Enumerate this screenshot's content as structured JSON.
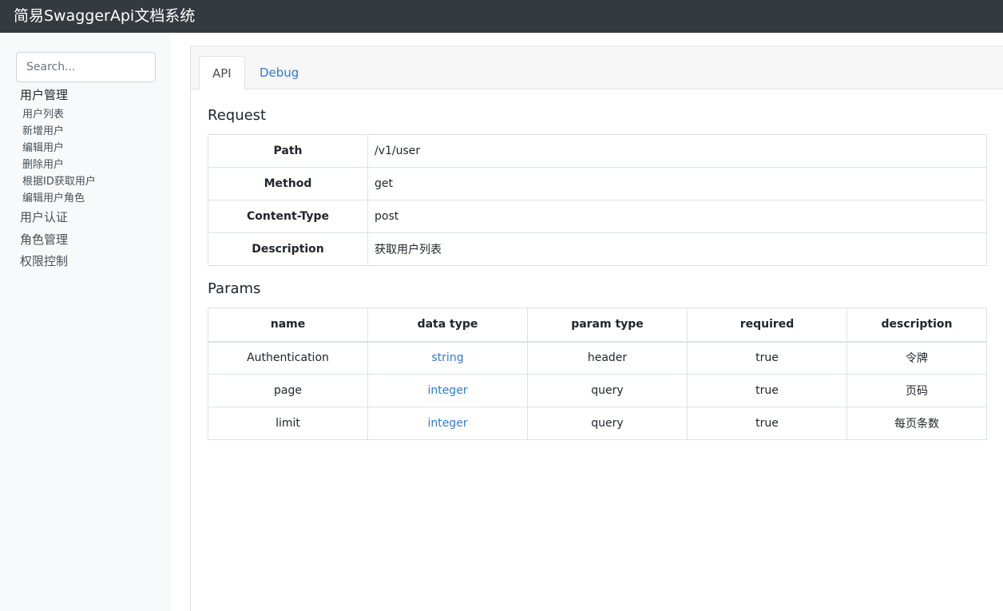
{
  "app": {
    "title": "简易SwaggerApi文档系统"
  },
  "sidebar": {
    "search_placeholder": "Search...",
    "groups": [
      {
        "label": "用户管理",
        "items": [
          "用户列表",
          "新增用户",
          "编辑用户",
          "删除用户",
          "根据ID获取用户",
          "编辑用户角色"
        ]
      },
      {
        "label": "用户认证"
      },
      {
        "label": "角色管理"
      },
      {
        "label": "权限控制"
      }
    ]
  },
  "tabs": [
    {
      "label": "API",
      "active": true
    },
    {
      "label": "Debug",
      "active": false
    }
  ],
  "request": {
    "heading": "Request",
    "rows": [
      {
        "key": "Path",
        "value": "/v1/user"
      },
      {
        "key": "Method",
        "value": "get"
      },
      {
        "key": "Content-Type",
        "value": "post"
      },
      {
        "key": "Description",
        "value": "获取用户列表"
      }
    ]
  },
  "params": {
    "heading": "Params",
    "headers": [
      "name",
      "data type",
      "param type",
      "required",
      "description"
    ],
    "rows": [
      [
        "Authentication",
        "string",
        "header",
        "true",
        "令牌"
      ],
      [
        "page",
        "integer",
        "query",
        "true",
        "页码"
      ],
      [
        "limit",
        "integer",
        "query",
        "true",
        "每页条数"
      ]
    ]
  },
  "colors": {
    "navbar": "#343a40",
    "link": "#2e7ad6",
    "sidebar_bg": "#f8f9fa"
  }
}
